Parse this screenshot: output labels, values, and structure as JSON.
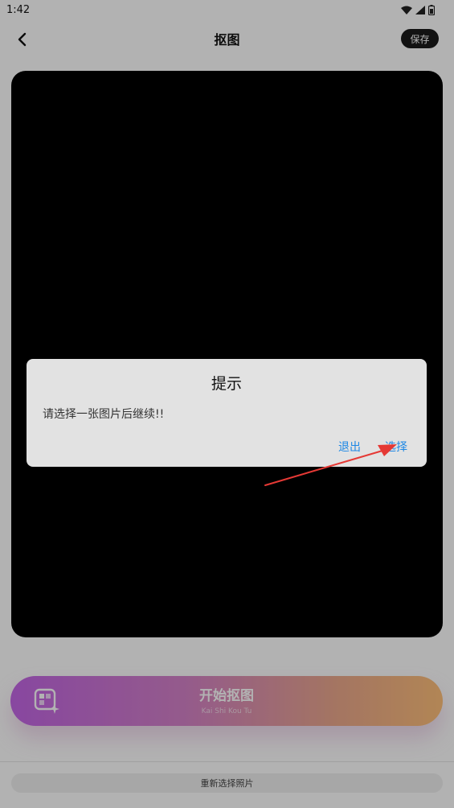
{
  "status_bar": {
    "time": "1:42",
    "icons": [
      "wifi-icon",
      "signal-icon",
      "battery-icon"
    ]
  },
  "app_bar": {
    "back_icon": "chevron-left-icon",
    "title": "抠图",
    "save_label": "保存"
  },
  "main": {
    "start_button": {
      "icon": "image-sparkle-icon",
      "title": "开始抠图",
      "subtitle": "Kai Shi Kou Tu"
    },
    "reselect_label": "重新选择照片"
  },
  "dialog": {
    "title": "提示",
    "message": "请选择一张图片后继续!!",
    "buttons": {
      "exit": "退出",
      "select": "选择"
    }
  },
  "colors": {
    "dialog_button": "#1e88e5",
    "save_button_bg": "#1b1b1b",
    "gradient_start": "#c366e6",
    "gradient_end": "#ffc07a",
    "annotation_arrow": "#e53935"
  }
}
